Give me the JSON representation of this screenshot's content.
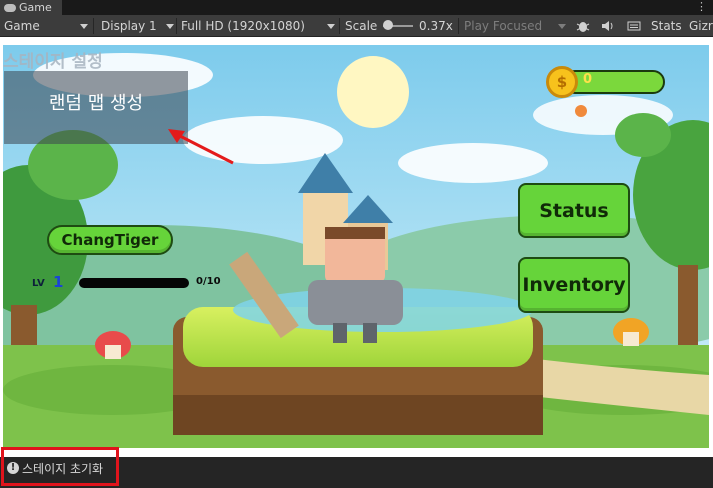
{
  "tab": {
    "title": "Game"
  },
  "toolbar": {
    "display_mode": "Game",
    "display": "Display 1",
    "resolution": "Full HD (1920x1080)",
    "scale_label": "Scale",
    "scale_value": "0.37x",
    "play_mode": "Play Focused",
    "stats": "Stats",
    "gizmos": "Gizr"
  },
  "game": {
    "stage_settings_title": "스테이지 설정",
    "random_map_button": "랜덤 맵 생성",
    "coins": "0",
    "player_name": "ChangTiger",
    "level_label": "LV",
    "level_value": "1",
    "exp_progress": 0,
    "exp_text": "0/10",
    "status_button": "Status",
    "inventory_button": "Inventory"
  },
  "statusbar": {
    "message": "스테이지 초기화"
  },
  "colors": {
    "accent_red": "#e0141c",
    "button_green": "#66d43a",
    "editor_dark": "#3c3c3c"
  }
}
